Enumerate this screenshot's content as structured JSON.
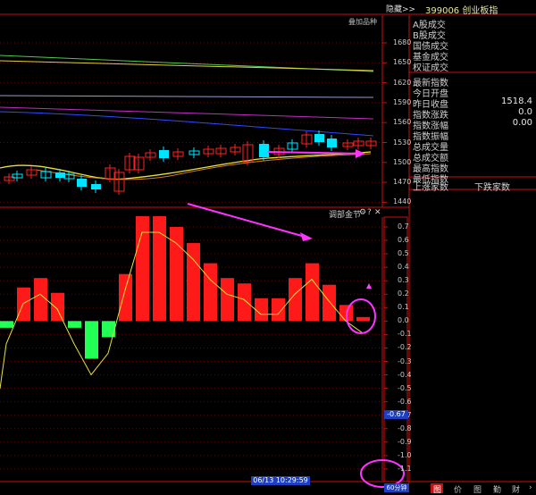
{
  "window": {
    "title": "399006 创业板指",
    "expand_label": "隐藏>>"
  },
  "kline": {
    "price_ticks": [
      "1680",
      "1650",
      "1620",
      "1590",
      "1560",
      "1530",
      "1500",
      "1470",
      "1440"
    ],
    "tl_label": "叠加品种"
  },
  "indicator": {
    "name": "调部金节",
    "ticks": [
      "0.7",
      "0.6",
      "0.5",
      "0.4",
      "0.3",
      "0.2",
      "0.1",
      "0.0",
      "-0.1",
      "-0.2",
      "-0.3",
      "-0.4",
      "-0.5",
      "-0.6",
      "-0.7",
      "-0.8",
      "-0.9",
      "-1.0",
      "-1.1"
    ],
    "current_value": "-0.67",
    "bars": [
      -0.05,
      0.25,
      0.32,
      0.21,
      -0.05,
      -0.28,
      -0.12,
      0.35,
      0.78,
      0.78,
      0.7,
      0.58,
      0.43,
      0.32,
      0.28,
      0.17,
      0.17,
      0.32,
      0.43,
      0.27,
      0.12,
      0.03
    ]
  },
  "right_panel": {
    "rows": [
      {
        "label": "A股成交",
        "value": ""
      },
      {
        "label": "B股成交",
        "value": ""
      },
      {
        "label": "国债成交",
        "value": ""
      },
      {
        "label": "基金成交",
        "value": ""
      },
      {
        "label": "权证成交",
        "value": ""
      },
      {
        "label": "最新指数",
        "value": ""
      },
      {
        "label": "今日开盘",
        "value": ""
      },
      {
        "label": "昨日收盘",
        "value": "1518.4"
      },
      {
        "label": "指数涨跌",
        "value": "0.0"
      },
      {
        "label": "指数涨幅",
        "value": "0.00"
      },
      {
        "label": "指数振幅",
        "value": ""
      },
      {
        "label": "总成交量",
        "value": ""
      },
      {
        "label": "总成交额",
        "value": ""
      },
      {
        "label": "最高指数",
        "value": ""
      },
      {
        "label": "最低指数",
        "value": ""
      }
    ],
    "up_label": "上涨家数",
    "down_label": "下跌家数"
  },
  "status": {
    "datetime": "06/13 10:29:59",
    "period": "60分钟"
  },
  "tabs": [
    "图",
    "价",
    "图",
    "勤",
    "财",
    "›"
  ],
  "colors": {
    "up": "#ff1a1a",
    "down": "#22ff55",
    "cyan": "#00e5ff",
    "axis": "#cc1111",
    "magenta": "#ff33ff",
    "ma_yellow": "#e7e13a"
  }
}
